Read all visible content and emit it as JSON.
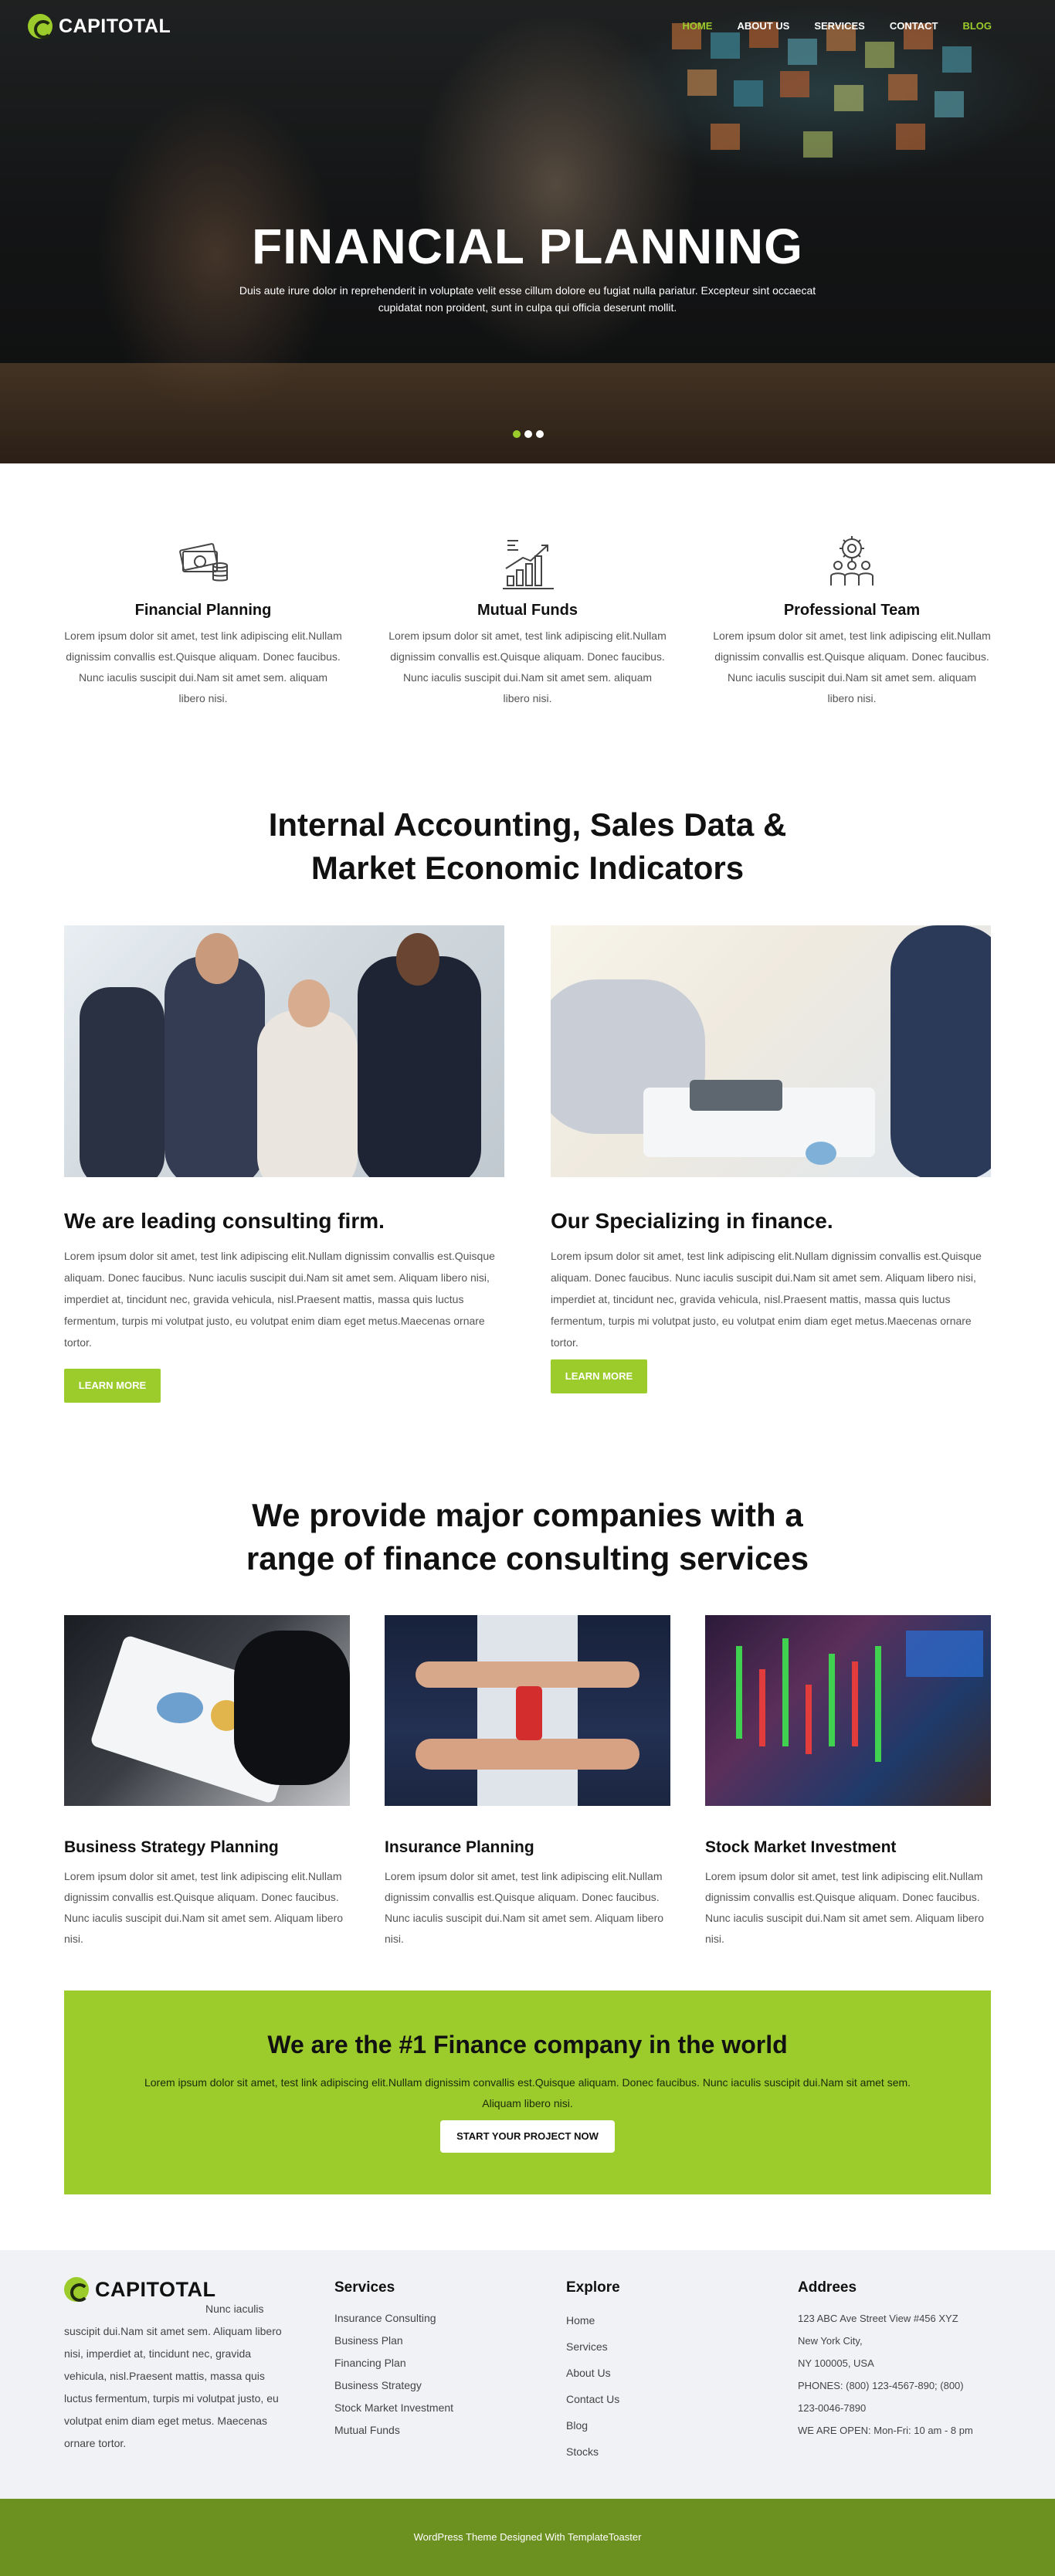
{
  "brand": {
    "name": "CAPITOTAL",
    "accent": "#9ccc2c",
    "footer_bar": "#6d9121"
  },
  "nav": {
    "items": [
      {
        "label": "HOME",
        "state": "active"
      },
      {
        "label": "ABOUT US"
      },
      {
        "label": "SERVICES"
      },
      {
        "label": "CONTACT"
      },
      {
        "label": "BLOG",
        "state": "accent"
      }
    ]
  },
  "hero": {
    "title": "FINANCIAL PLANNING",
    "subtitle": "Duis aute irure dolor in reprehenderit in voluptate velit esse cillum dolore eu fugiat nulla pariatur. Excepteur sint occaecat cupidatat non proident, sunt in culpa qui officia deserunt mollit.",
    "slides": 3,
    "active_slide": 1
  },
  "features": [
    {
      "title": "Financial Planning",
      "icon": "money-coins-icon",
      "text": "Lorem ipsum dolor sit amet, test link adipiscing elit.Nullam dignissim convallis est.Quisque aliquam. Donec faucibus. Nunc iaculis suscipit dui.Nam sit amet sem. aliquam libero nisi."
    },
    {
      "title": "Mutual Funds",
      "icon": "growth-chart-icon",
      "text": "Lorem ipsum dolor sit amet, test link adipiscing elit.Nullam dignissim convallis est.Quisque aliquam. Donec faucibus. Nunc iaculis suscipit dui.Nam sit amet sem. aliquam libero nisi."
    },
    {
      "title": "Professional Team",
      "icon": "team-gear-icon",
      "text": "Lorem ipsum dolor sit amet, test link adipiscing elit.Nullam dignissim convallis est.Quisque aliquam. Donec faucibus. Nunc iaculis suscipit dui.Nam sit amet sem. aliquam libero nisi."
    }
  ],
  "accounting": {
    "title_line1": "Internal Accounting, Sales Data &",
    "title_line2": "Market Economic Indicators",
    "columns": [
      {
        "title": "We are leading consulting firm.",
        "text": "Lorem ipsum dolor sit amet, test link adipiscing elit.Nullam dignissim convallis est.Quisque aliquam. Donec faucibus. Nunc iaculis suscipit dui.Nam sit amet sem. Aliquam libero nisi, imperdiet at, tincidunt nec, gravida vehicula, nisl.Praesent mattis, massa quis luctus fermentum, turpis mi volutpat justo, eu volutpat enim diam eget metus.Maecenas ornare tortor.",
        "button": "LEARN MORE"
      },
      {
        "title": "Our Specializing in finance.",
        "text": "Lorem ipsum dolor sit amet, test link adipiscing elit.Nullam dignissim convallis est.Quisque aliquam. Donec faucibus. Nunc iaculis suscipit dui.Nam sit amet sem. Aliquam libero nisi, imperdiet at, tincidunt nec, gravida vehicula, nisl.Praesent mattis, massa quis luctus fermentum, turpis mi volutpat justo, eu volutpat enim diam eget metus.Maecenas ornare tortor.",
        "button": "LEARN MORE"
      }
    ]
  },
  "services": {
    "title_line1": "We provide major companies with a",
    "title_line2": "range of finance consulting services",
    "items": [
      {
        "title": "Business Strategy Planning",
        "text": "Lorem ipsum dolor sit amet, test link adipiscing elit.Nullam dignissim convallis est.Quisque aliquam. Donec faucibus. Nunc iaculis suscipit dui.Nam sit amet sem. Aliquam libero nisi."
      },
      {
        "title": "Insurance Planning",
        "text": "Lorem ipsum dolor sit amet, test link adipiscing elit.Nullam dignissim convallis est.Quisque aliquam. Donec faucibus. Nunc iaculis suscipit dui.Nam sit amet sem. Aliquam libero nisi."
      },
      {
        "title": "Stock Market Investment",
        "text": "Lorem ipsum dolor sit amet, test link adipiscing elit.Nullam dignissim convallis est.Quisque aliquam. Donec faucibus. Nunc iaculis suscipit dui.Nam sit amet sem. Aliquam libero nisi."
      }
    ]
  },
  "cta": {
    "title": "We are the #1 Finance company in the world",
    "text": "Lorem ipsum dolor sit amet, test link adipiscing elit.Nullam dignissim convallis est.Quisque aliquam. Donec faucibus. Nunc iaculis suscipit dui.Nam sit amet sem. Aliquam libero nisi.",
    "button": "START YOUR PROJECT NOW"
  },
  "footer": {
    "logo": "CAPITOTAL",
    "about": "Nunc iaculis suscipit dui.Nam sit amet sem. Aliquam libero nisi, imperdiet at, tincidunt nec, gravida vehicula, nisl.Praesent mattis, massa quis luctus fermentum, turpis mi volutpat justo, eu volutpat enim diam eget metus. Maecenas ornare tortor.",
    "services": {
      "title": "Services",
      "items": [
        "Insurance Consulting",
        "Business Plan",
        "Financing Plan",
        "Business Strategy",
        "Stock Market Investment",
        "Mutual Funds"
      ]
    },
    "explore": {
      "title": "Explore",
      "items": [
        "Home",
        "Services",
        "About Us",
        "Contact Us",
        "Blog",
        "Stocks"
      ]
    },
    "address": {
      "title": "Addrees",
      "lines": [
        "123 ABC Ave Street View #456 XYZ",
        "New York City,",
        "NY 100005, USA",
        "PHONES: (800) 123-4567-890; (800)",
        "123-0046-7890",
        "WE ARE OPEN: Mon-Fri: 10 am - 8 pm"
      ]
    },
    "credit": "WordPress Theme Designed With TemplateToaster"
  }
}
